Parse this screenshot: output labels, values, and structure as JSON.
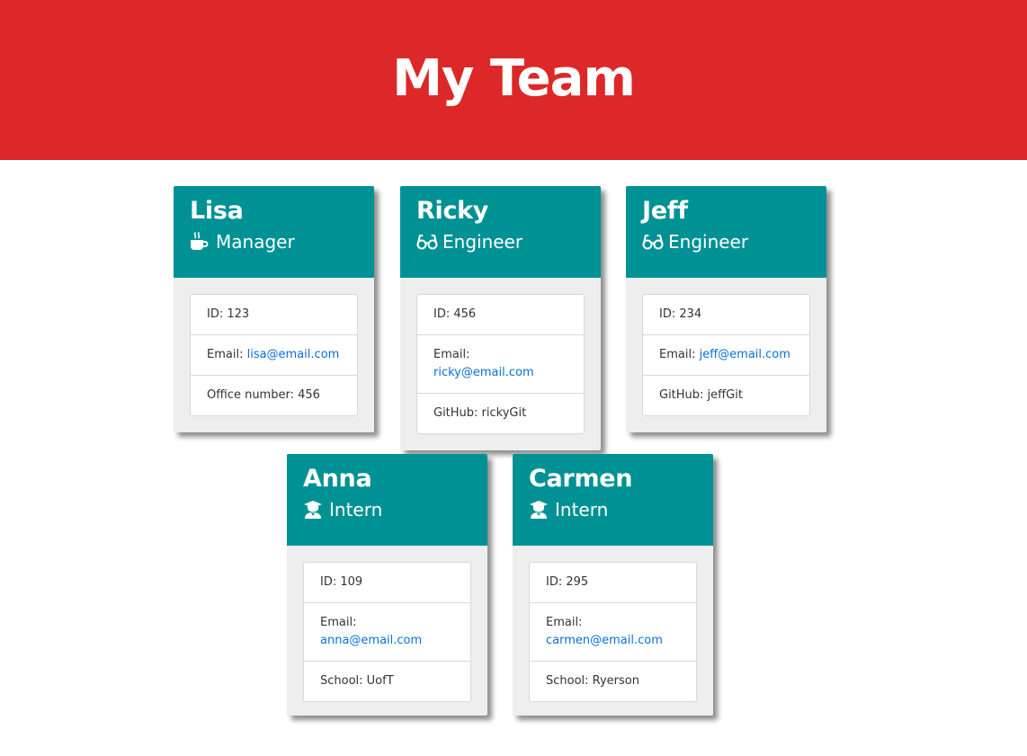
{
  "page": {
    "title": "My Team"
  },
  "colors": {
    "header_bg": "#dc2828",
    "card_head_bg": "#009194",
    "link": "#0a6fd6"
  },
  "cards": [
    {
      "name": "Lisa",
      "role": "Manager",
      "icon": "coffee-icon",
      "id_label": "ID: 123",
      "email_label": "Email:",
      "email": "lisa@email.com",
      "extra": "Office number: 456"
    },
    {
      "name": "Ricky",
      "role": "Engineer",
      "icon": "glasses-icon",
      "id_label": "ID: 456",
      "email_label": "Email:",
      "email": "ricky@email.com",
      "extra": "GitHub: rickyGit"
    },
    {
      "name": "Jeff",
      "role": "Engineer",
      "icon": "glasses-icon",
      "id_label": "ID: 234",
      "email_label": "Email:",
      "email": "jeff@email.com",
      "extra": "GitHub: jeffGit"
    },
    {
      "name": "Anna",
      "role": "Intern",
      "icon": "graduate-icon",
      "id_label": "ID: 109",
      "email_label": "Email:",
      "email": "anna@email.com",
      "extra": "School: UofT"
    },
    {
      "name": "Carmen",
      "role": "Intern",
      "icon": "graduate-icon",
      "id_label": "ID: 295",
      "email_label": "Email:",
      "email": "carmen@email.com",
      "extra": "School: Ryerson"
    }
  ]
}
